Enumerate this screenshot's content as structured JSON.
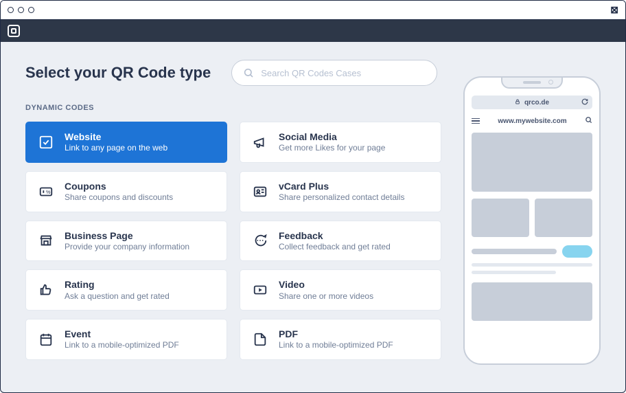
{
  "heading": "Select your QR Code type",
  "search": {
    "placeholder": "Search QR Codes Cases"
  },
  "section_label": "DYNAMIC CODES",
  "cards": [
    {
      "title": "Website",
      "sub": "Link to any page on the web"
    },
    {
      "title": "Social Media",
      "sub": "Get more Likes for your page"
    },
    {
      "title": "Coupons",
      "sub": "Share coupons and discounts"
    },
    {
      "title": "vCard Plus",
      "sub": "Share personalized contact details"
    },
    {
      "title": "Business Page",
      "sub": "Provide your company information"
    },
    {
      "title": "Feedback",
      "sub": "Collect feedback and get rated"
    },
    {
      "title": "Rating",
      "sub": "Ask a question and get rated"
    },
    {
      "title": "Video",
      "sub": "Share one or more videos"
    },
    {
      "title": "Event",
      "sub": "Link to a mobile-optimized PDF"
    },
    {
      "title": "PDF",
      "sub": "Link to a mobile-optimized PDF"
    }
  ],
  "preview": {
    "domain": "qrco.de",
    "url": "www.mywebsite.com"
  }
}
